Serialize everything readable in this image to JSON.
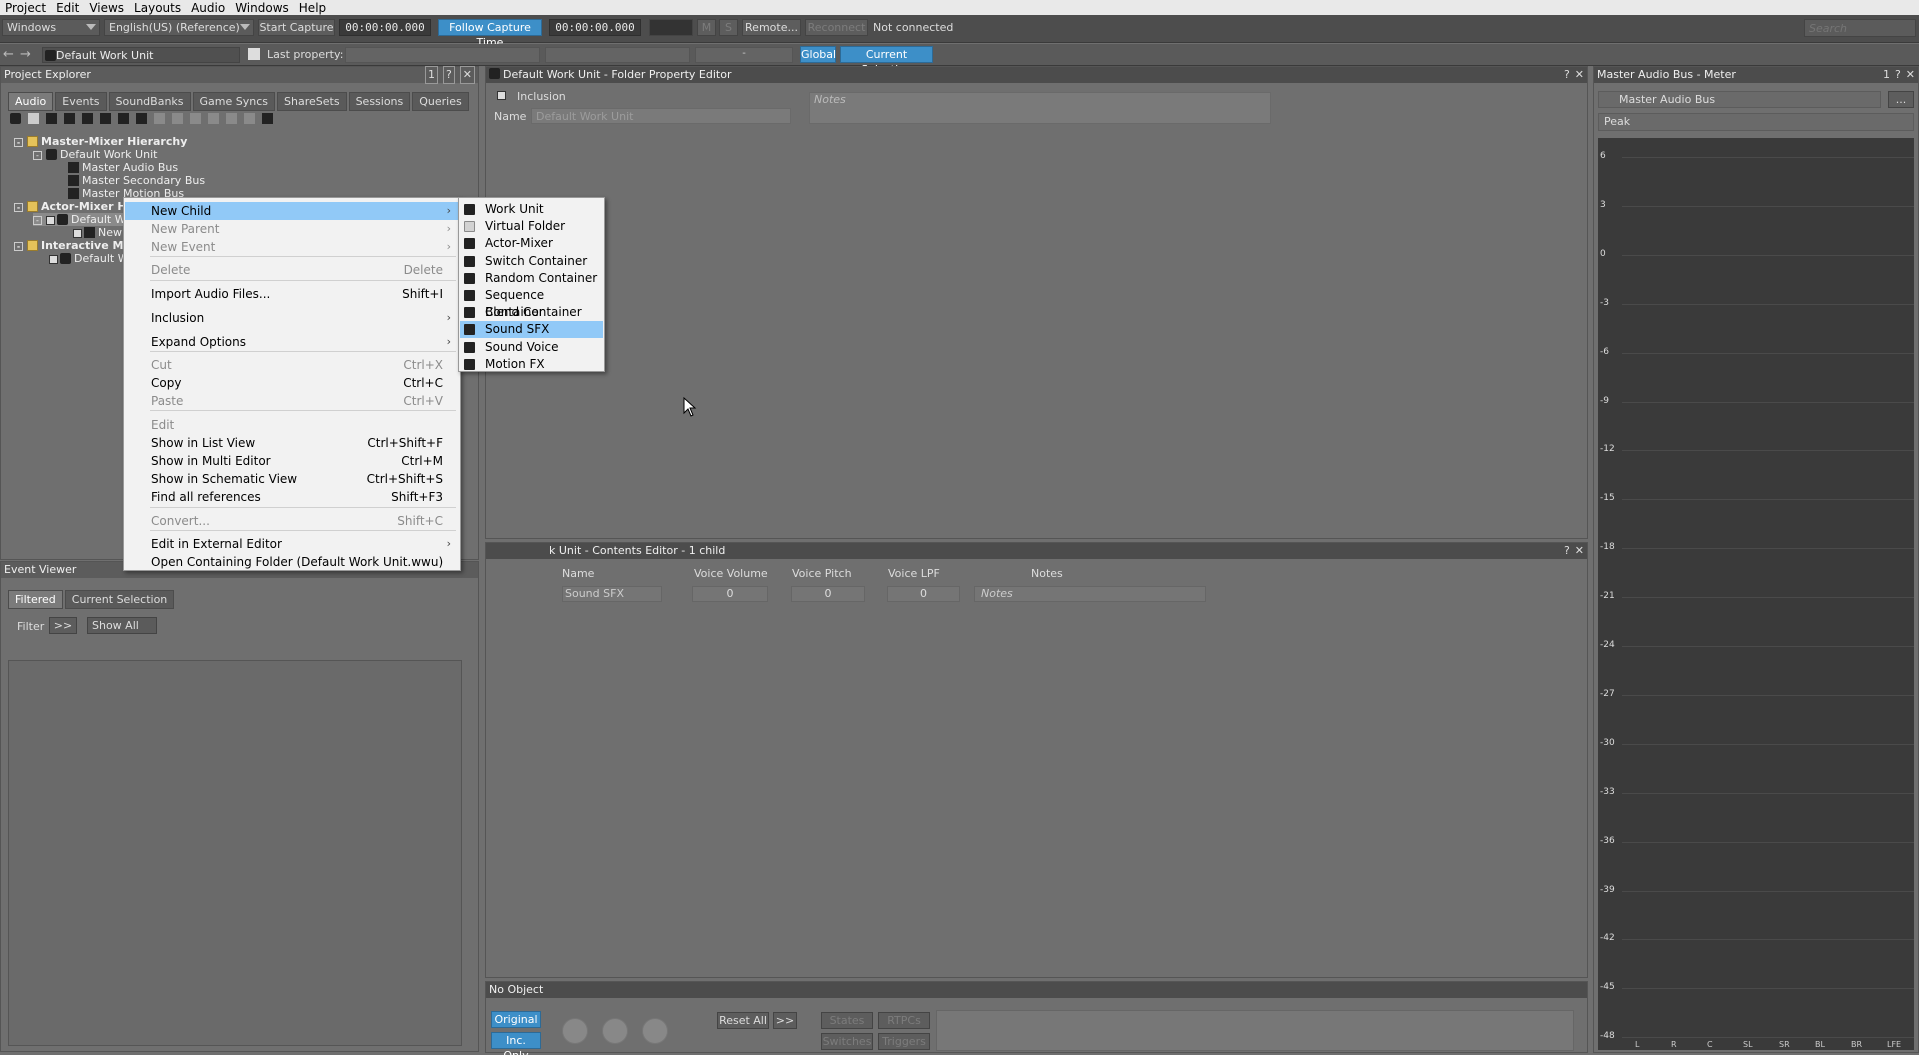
{
  "menubar": [
    "Project",
    "Edit",
    "Views",
    "Layouts",
    "Audio",
    "Windows",
    "Help"
  ],
  "toolbar": {
    "layout_combo": "Windows",
    "language_combo": "English(US) (Reference)",
    "start_capture": "Start Capture",
    "time1": "00:00:00.000",
    "follow_capture": "Follow Capture Time",
    "time2": "00:00:00.000",
    "m_btn": "M",
    "s_btn": "S",
    "remote": "Remote...",
    "reconnect": "Reconnect",
    "status": "Not connected",
    "search_placeholder": "Search",
    "workunit": "Default Work Unit",
    "last_property_label": "Last property:",
    "dash": "-",
    "global": "Global",
    "current_selection": "Current Selection"
  },
  "project_explorer": {
    "title": "Project Explorer",
    "title_num": "1",
    "tabs": [
      "Audio",
      "Events",
      "SoundBanks",
      "Game Syncs",
      "ShareSets",
      "Sessions",
      "Queries"
    ],
    "tree": [
      "Master-Mixer Hierarchy",
      "Default Work Unit",
      "Master Audio Bus",
      "Master Secondary Bus",
      "Master Motion Bus",
      "Actor-Mixer Hierarchy",
      "Default Work Unit",
      "New Sou",
      "Interactive Music",
      "Default Work"
    ]
  },
  "event_viewer": {
    "title": "Event Viewer",
    "tabs": [
      "Filtered",
      "Current Selection"
    ],
    "filter_label": "Filter",
    "filter_btn": ">>",
    "show_all": "Show All"
  },
  "property_editor": {
    "title": "Default Work Unit - Folder Property Editor",
    "inclusion": "Inclusion",
    "name_label": "Name",
    "name_value": "Default Work Unit",
    "notes": "Notes"
  },
  "contents_editor": {
    "title": "k Unit - Contents Editor - 1 child",
    "columns": [
      "Name",
      "Voice Volume",
      "Voice Pitch",
      "Voice LPF",
      "Notes"
    ],
    "row": {
      "name": "Sound SFX",
      "volume": "0",
      "pitch": "0",
      "lpf": "0",
      "notes": "Notes"
    }
  },
  "transport": {
    "title": "No Object",
    "original": "Original",
    "inc_only": "Inc. Only",
    "reset_all": "Reset All",
    "more": ">>",
    "states": "States",
    "rtpcs": "RTPCs",
    "switches": "Switches",
    "triggers": "Triggers"
  },
  "meter": {
    "title": "Master Audio Bus - Meter",
    "title_num": "1",
    "bus": "Master Audio Bus",
    "more": "...",
    "mode": "Peak",
    "ticks": [
      "6",
      "3",
      "0",
      "-3",
      "-6",
      "-9",
      "-12",
      "-15",
      "-18",
      "-21",
      "-24",
      "-27",
      "-30",
      "-33",
      "-36",
      "-39",
      "-42",
      "-45",
      "-48"
    ],
    "channels": [
      "L",
      "R",
      "C",
      "SL",
      "SR",
      "BL",
      "BR",
      "LFE"
    ]
  },
  "context_menu": [
    {
      "label": "New Child",
      "shortcut": "",
      "submenu": true,
      "state": "selected"
    },
    {
      "label": "New Parent",
      "shortcut": "",
      "submenu": true,
      "state": "disabled"
    },
    {
      "label": "New Event",
      "shortcut": "",
      "submenu": true,
      "state": "disabled"
    },
    {
      "label": "Delete",
      "shortcut": "Delete",
      "submenu": false,
      "state": "disabled"
    },
    {
      "label": "Import Audio Files...",
      "shortcut": "Shift+I",
      "submenu": false,
      "state": "normal"
    },
    {
      "label": "Inclusion",
      "shortcut": "",
      "submenu": true,
      "state": "normal"
    },
    {
      "label": "Expand Options",
      "shortcut": "",
      "submenu": true,
      "state": "normal"
    },
    {
      "label": "Cut",
      "shortcut": "Ctrl+X",
      "submenu": false,
      "state": "disabled"
    },
    {
      "label": "Copy",
      "shortcut": "Ctrl+C",
      "submenu": false,
      "state": "normal"
    },
    {
      "label": "Paste",
      "shortcut": "Ctrl+V",
      "submenu": false,
      "state": "disabled"
    },
    {
      "label": "Edit",
      "shortcut": "",
      "submenu": false,
      "state": "disabled"
    },
    {
      "label": "Show in List View",
      "shortcut": "Ctrl+Shift+F",
      "submenu": false,
      "state": "normal"
    },
    {
      "label": "Show in Multi Editor",
      "shortcut": "Ctrl+M",
      "submenu": false,
      "state": "normal"
    },
    {
      "label": "Show in Schematic View",
      "shortcut": "Ctrl+Shift+S",
      "submenu": false,
      "state": "normal"
    },
    {
      "label": "Find all references",
      "shortcut": "Shift+F3",
      "submenu": false,
      "state": "normal"
    },
    {
      "label": "Convert...",
      "shortcut": "Shift+C",
      "submenu": false,
      "state": "disabled"
    },
    {
      "label": "Edit in External Editor",
      "shortcut": "",
      "submenu": true,
      "state": "normal"
    },
    {
      "label": "Open Containing Folder (Default Work Unit.wwu)",
      "shortcut": "",
      "submenu": false,
      "state": "normal"
    }
  ],
  "submenu": [
    {
      "label": "Work Unit",
      "icon": "work-unit-icon"
    },
    {
      "label": "Virtual Folder",
      "icon": "folder-icon"
    },
    {
      "label": "Actor-Mixer",
      "icon": "actor-mixer-icon"
    },
    {
      "label": "Switch Container",
      "icon": "switch-container-icon"
    },
    {
      "label": "Random Container",
      "icon": "random-container-icon"
    },
    {
      "label": "Sequence Container",
      "icon": "sequence-container-icon"
    },
    {
      "label": "Blend Container",
      "icon": "blend-container-icon"
    },
    {
      "label": "Sound SFX",
      "icon": "sound-sfx-icon",
      "selected": true
    },
    {
      "label": "Sound Voice",
      "icon": "sound-voice-icon"
    },
    {
      "label": "Motion FX",
      "icon": "motion-fx-icon"
    }
  ]
}
